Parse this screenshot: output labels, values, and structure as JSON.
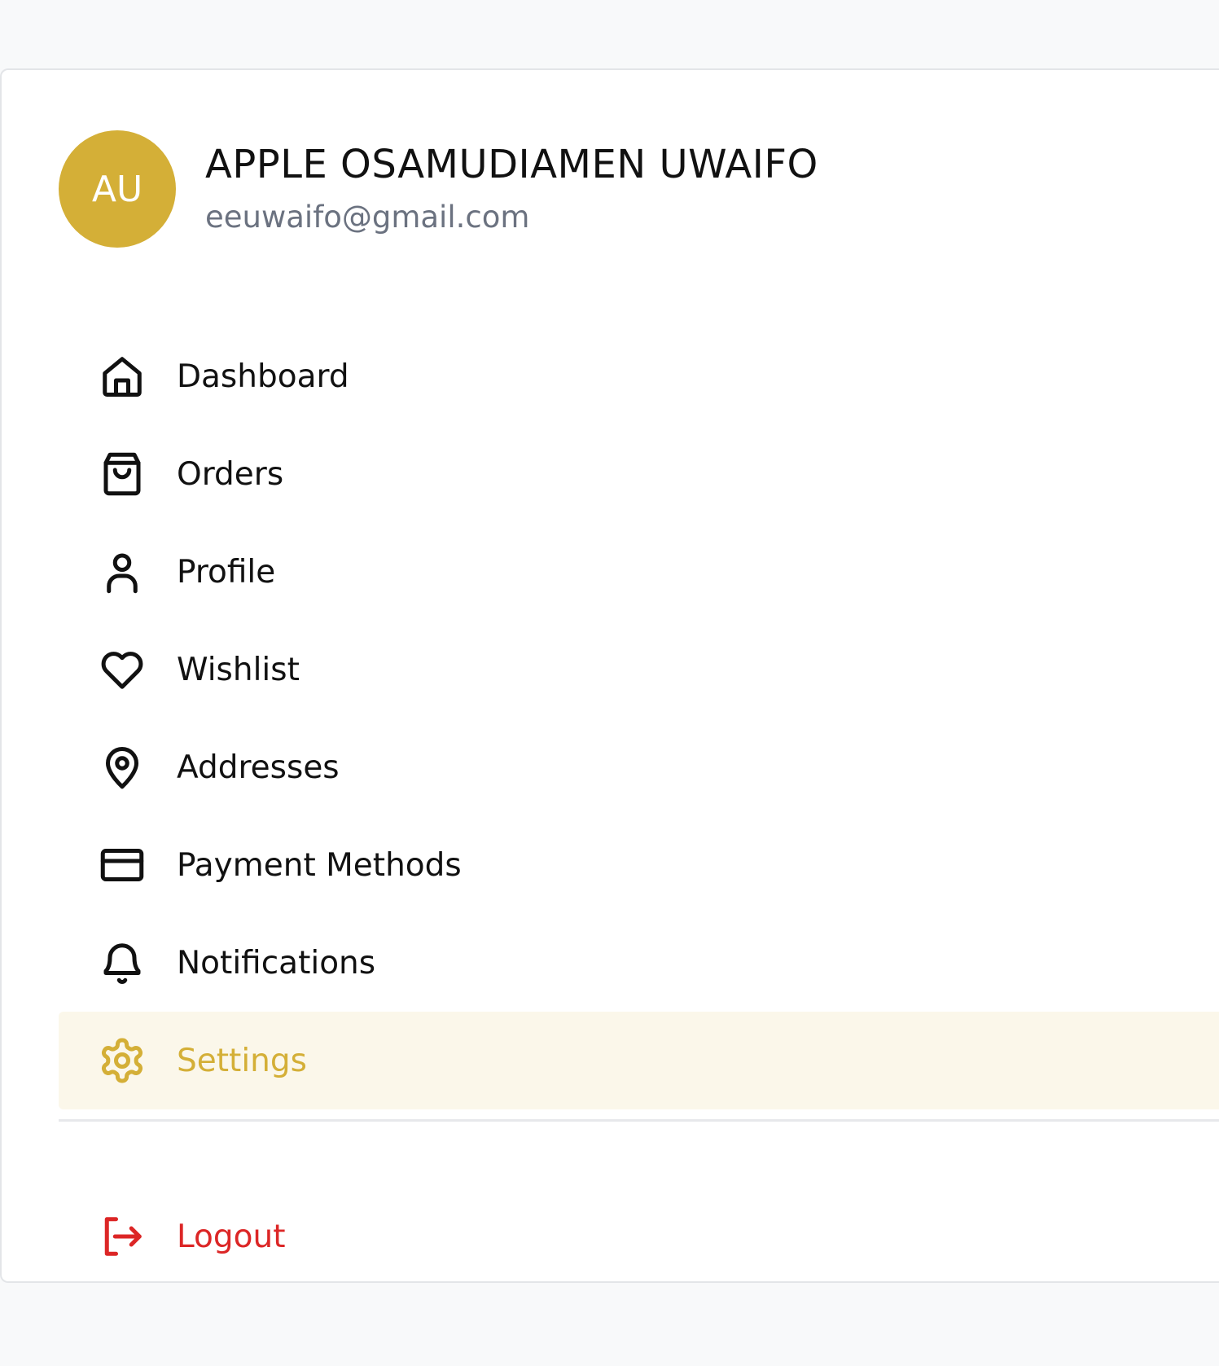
{
  "profile": {
    "initials": "AU",
    "name": "APPLE OSAMUDIAMEN UWAIFO",
    "email": "eeuwaifo@gmail.com"
  },
  "nav": {
    "items": [
      {
        "label": "Dashboard",
        "icon": "home-icon"
      },
      {
        "label": "Orders",
        "icon": "shopping-bag-icon"
      },
      {
        "label": "Profile",
        "icon": "user-icon"
      },
      {
        "label": "Wishlist",
        "icon": "heart-icon"
      },
      {
        "label": "Addresses",
        "icon": "map-pin-icon"
      },
      {
        "label": "Payment Methods",
        "icon": "credit-card-icon"
      },
      {
        "label": "Notifications",
        "icon": "bell-icon"
      },
      {
        "label": "Settings",
        "icon": "gear-icon",
        "active": true
      }
    ],
    "logout": {
      "label": "Logout",
      "icon": "logout-icon"
    }
  },
  "colors": {
    "accent": "#d4af37",
    "active_background": "#fbf7ea",
    "danger": "#dc2626",
    "page_background": "#f8f9fa"
  }
}
